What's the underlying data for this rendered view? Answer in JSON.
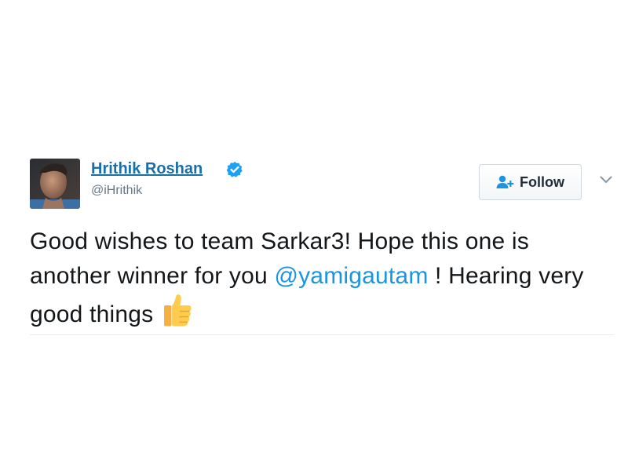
{
  "tweet": {
    "author": {
      "name": "Hrithik Roshan",
      "handle": "@iHrithik",
      "verified": true
    },
    "follow_button": {
      "label": "Follow",
      "icon": "add-user-icon"
    },
    "menu_icon": "chevron-down-icon",
    "text_part1": "Good wishes to team Sarkar3! Hope this one is another winner for you ",
    "mention": "@yamigautam",
    "text_part2": " ! Hearing very good things",
    "emoji": "thumbs-up-icon"
  },
  "colors": {
    "link_blue": "#1b6fa8",
    "mention_blue": "#1b95e0",
    "handle_gray": "#657786",
    "verified_blue": "#1da1f2"
  }
}
